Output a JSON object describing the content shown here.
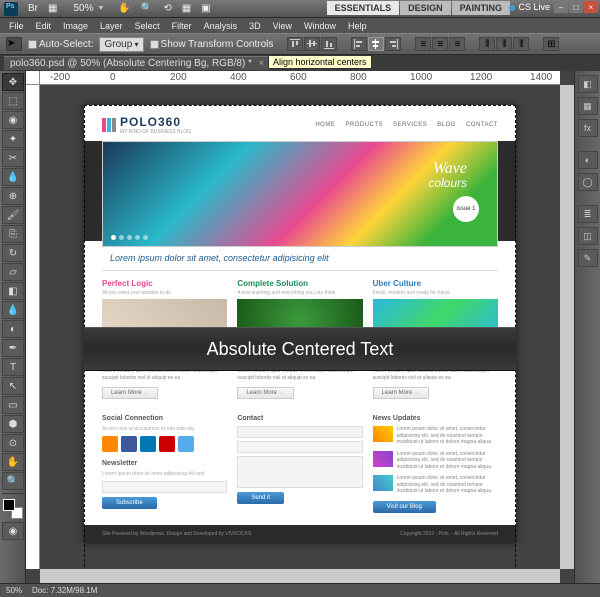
{
  "menubar": {
    "zoom_value": "50%"
  },
  "workspaces": {
    "essentials": "ESSENTIALS",
    "design": "DESIGN",
    "painting": "PAINTING"
  },
  "cslive": "CS Live",
  "appmenu": {
    "file": "File",
    "edit": "Edit",
    "image": "Image",
    "layer": "Layer",
    "select": "Select",
    "filter": "Filter",
    "analysis": "Analysis",
    "threed": "3D",
    "view": "View",
    "window": "Window",
    "help": "Help"
  },
  "options": {
    "auto_select": "Auto-Select:",
    "group": "Group",
    "show_transform": "Show Transform Controls"
  },
  "tooltip": "Align horizontal centers",
  "doc": {
    "title": "polo360.psd @ 50% (Absolute Centering Bg, RGB/8) *"
  },
  "ruler_marks": [
    "-200",
    "0",
    "200",
    "400",
    "600",
    "800",
    "1000",
    "1200",
    "1400"
  ],
  "site": {
    "logo_text": "POLO360",
    "logo_sub": "MY KIND OF BUSINESS BLOG",
    "nav": [
      "HOME",
      "PRODUCTS",
      "SERVICES",
      "BLOG",
      "CONTACT"
    ],
    "hero_wave": "Wave",
    "hero_colours": "colours",
    "hero_issue": "issue 1",
    "tagline": "Lorem ipsum dolor sit amet, consectetur adipisicing elit",
    "cols": [
      {
        "title": "Perfect Logic",
        "sub": "All you want your website to do",
        "body": "Lorem ipsum dolor sit amet, consectetuer adipiscing elit, sed diam nonummy nibh euismod tincidunt ut laoreet dolore magna aliquam erat volutpat. Ut wisi enim ad minim veniam, quis nostrud exerci tation ullamcorper suscipit lobortis nisl ut aliquip ex ea"
      },
      {
        "title": "Complete Solution",
        "sub": "A tool anything and everything you can think",
        "body": "Lorem ipsum dolor sit amet, consectetuer adipiscing elit, sed diam nonummy nibh euismod tincidunt ut laoreet dolore magna aliquam erat volutpat. Ut wisi enim ad minim veniam, quis nostrud exerci tation ullamcorper suscipit lobortis nisl ut aliquip ex ea"
      },
      {
        "title": "Uber Culture",
        "sub": "Fresh, modern and ready for future",
        "body": "Lorem ipsum dolor sit amet, consectetuer adipiscing elit, sed diam nonummy nibh euismod tincidunt ut laoreet dolore magna aliquam erat volutpat. Ut wisi enim ad minim veniam, quis nostrud exerci tation ullamcorper suscipit lobortis nisl ut aliquip ex ea"
      }
    ],
    "learn_more": "Learn More",
    "overlay": "Absolute Centered Text",
    "social_h": "Social Connection",
    "social_sub": "At vero eos at accusamus et tuto adio dig",
    "newsletter_h": "Newsletter",
    "newsletter_sub": "Lorem ipsum dolor sit amet adipisicing elit sed",
    "subscribe": "Subscribe",
    "contact_h": "Contact",
    "send": "Send it",
    "news_h": "News Updates",
    "news_body": "Lorem ipsum dolor sit amet, consectetur adipisicing elit, sed do eiusmod tempor incididunt ut labore et dolore magna aliqua.",
    "news_btn": "Visit our Blog",
    "footer_l": "Site Powered by Wordpress. Design and Developed by VIVROCKS",
    "footer_r": "Copyright 2012 - Polo. - All Rights Reserved"
  },
  "status": {
    "zoom": "50%",
    "doc": "Doc: 7.32M/98.1M"
  }
}
